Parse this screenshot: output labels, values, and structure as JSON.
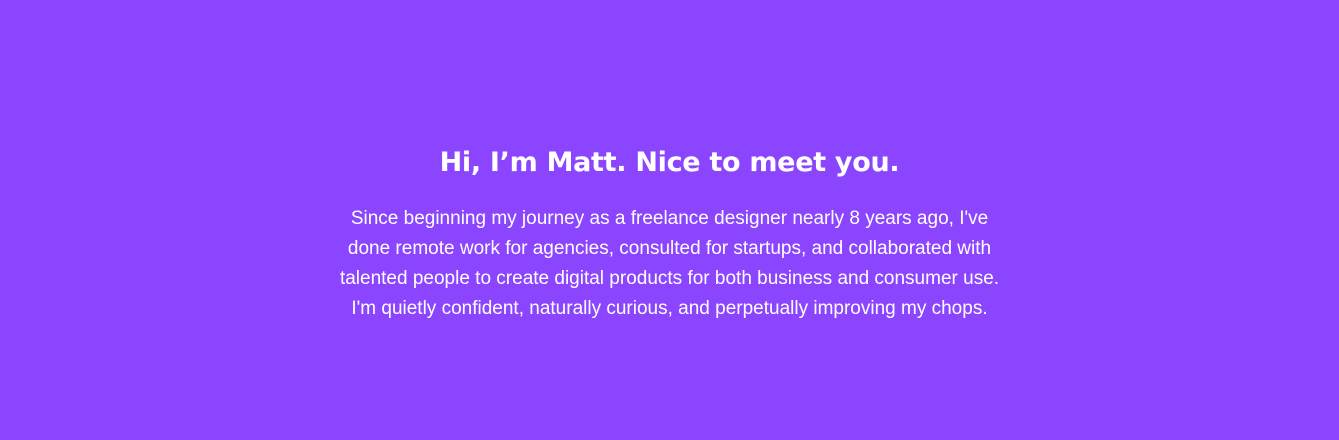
{
  "hero": {
    "title": "Hi, I’m Matt. Nice to meet you.",
    "body_lines": [
      "Since beginning my journey as a freelance designer nearly 8 years ago, I've",
      "done remote work for agencies, consulted for startups, and collaborated with",
      "talented people to create digital products for both business and consumer use.",
      "I'm quietly confident, naturally curious, and perpetually improving my chops."
    ]
  },
  "colors": {
    "background": "#8c45ff",
    "text": "#ffffff"
  }
}
